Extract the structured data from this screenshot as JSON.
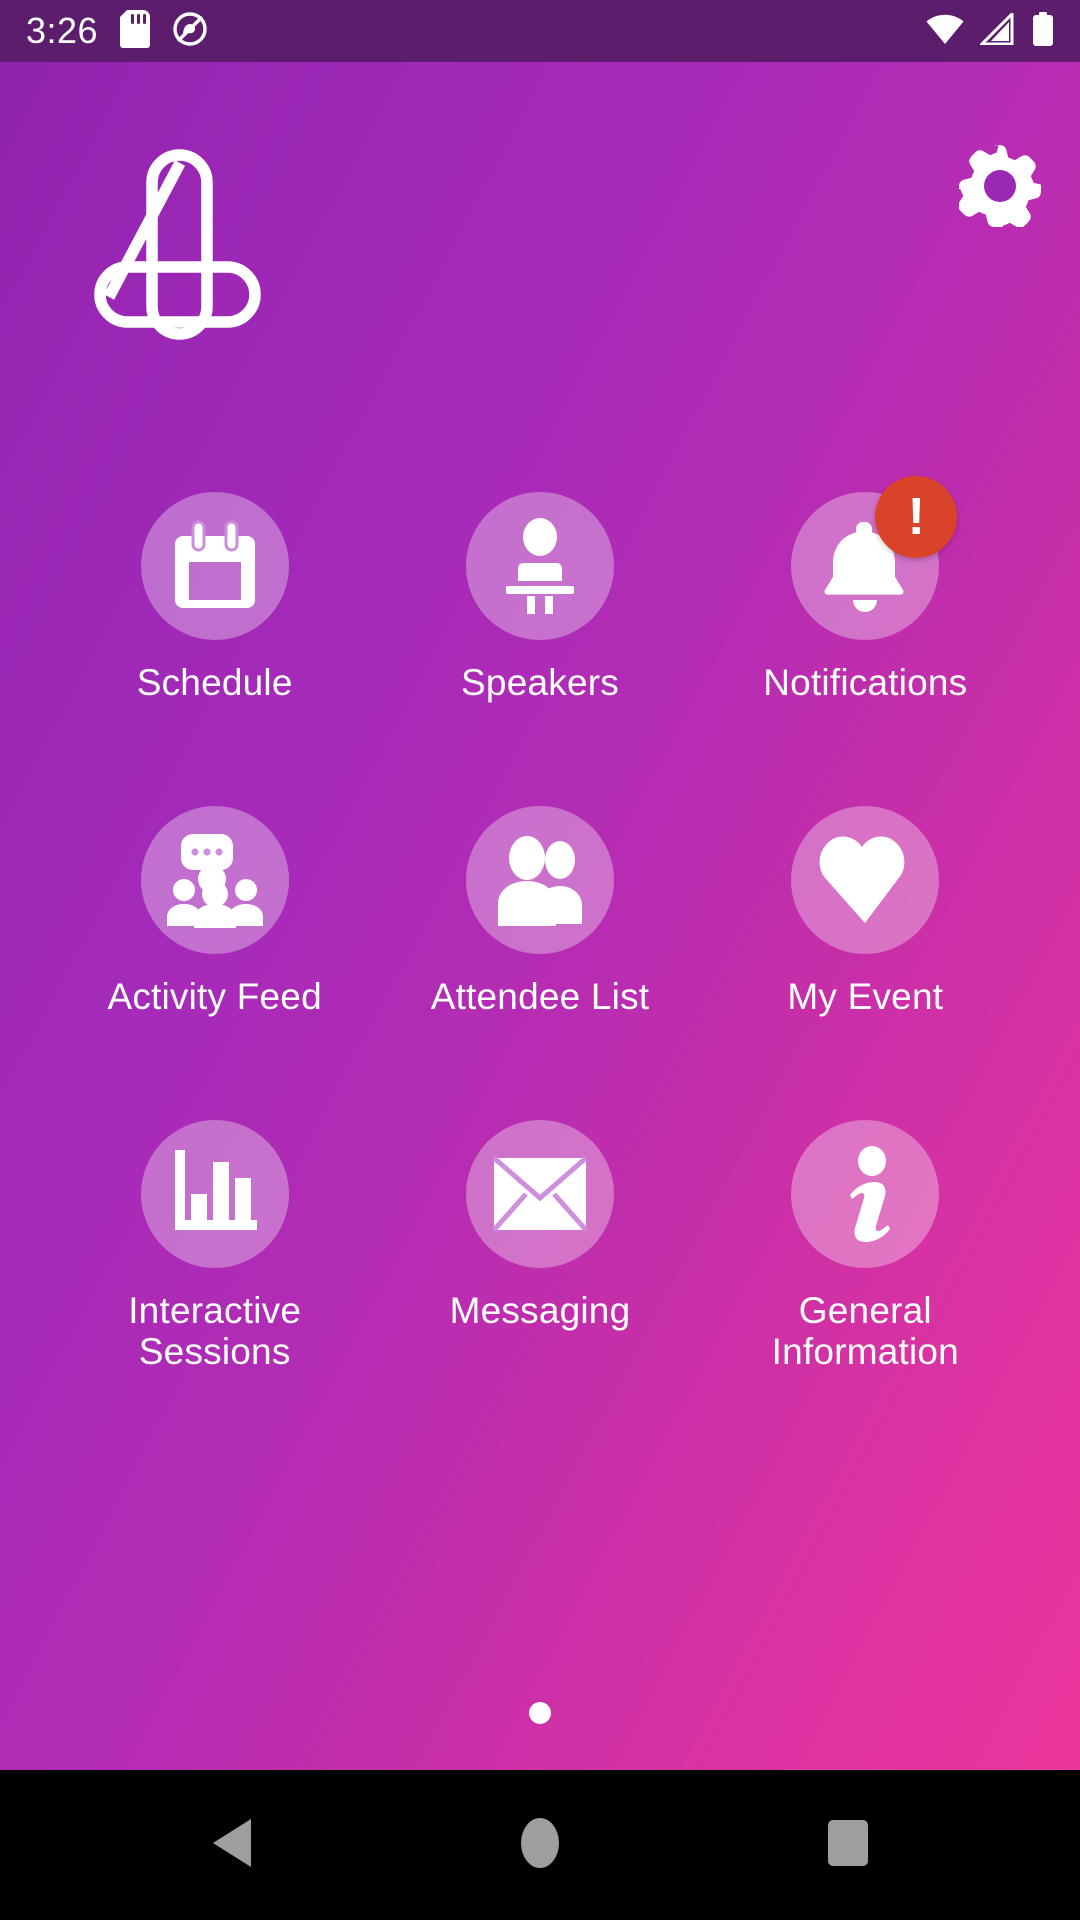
{
  "status_bar": {
    "clock": "3:26",
    "left_icons": [
      "sd-card-icon",
      "do-not-disturb-icon"
    ],
    "right_icons": [
      "wifi-icon",
      "cellular-signal-icon",
      "battery-icon"
    ],
    "background_color": "#5B1D6C"
  },
  "header": {
    "logo_name": "app-logo-four",
    "settings_label": "gear-icon"
  },
  "theme": {
    "gradient_start": "#9B27B5",
    "gradient_end": "#EC359C",
    "tile_circle": "rgba(255,255,255,0.33)",
    "badge_color": "#D8432A",
    "text_color": "#FFFFFF"
  },
  "grid": {
    "tiles": [
      {
        "label": "Schedule",
        "icon": "calendar-icon",
        "badge": null
      },
      {
        "label": "Speakers",
        "icon": "podium-icon",
        "badge": null
      },
      {
        "label": "Notifications",
        "icon": "bell-icon",
        "badge": "!"
      },
      {
        "label": "Activity Feed",
        "icon": "group-chat-icon",
        "badge": null
      },
      {
        "label": "Attendee List",
        "icon": "people-icon",
        "badge": null
      },
      {
        "label": "My Event",
        "icon": "heart-icon",
        "badge": null
      },
      {
        "label": "Interactive\nSessions",
        "icon": "bar-chart-icon",
        "badge": null
      },
      {
        "label": "Messaging",
        "icon": "envelope-icon",
        "badge": null
      },
      {
        "label": "General\nInformation",
        "icon": "info-icon",
        "badge": null
      }
    ]
  },
  "pagination": {
    "pages": 1,
    "current": 1
  },
  "nav_bar": {
    "back_label": "back-icon",
    "home_label": "home-icon",
    "recents_label": "recents-icon"
  }
}
